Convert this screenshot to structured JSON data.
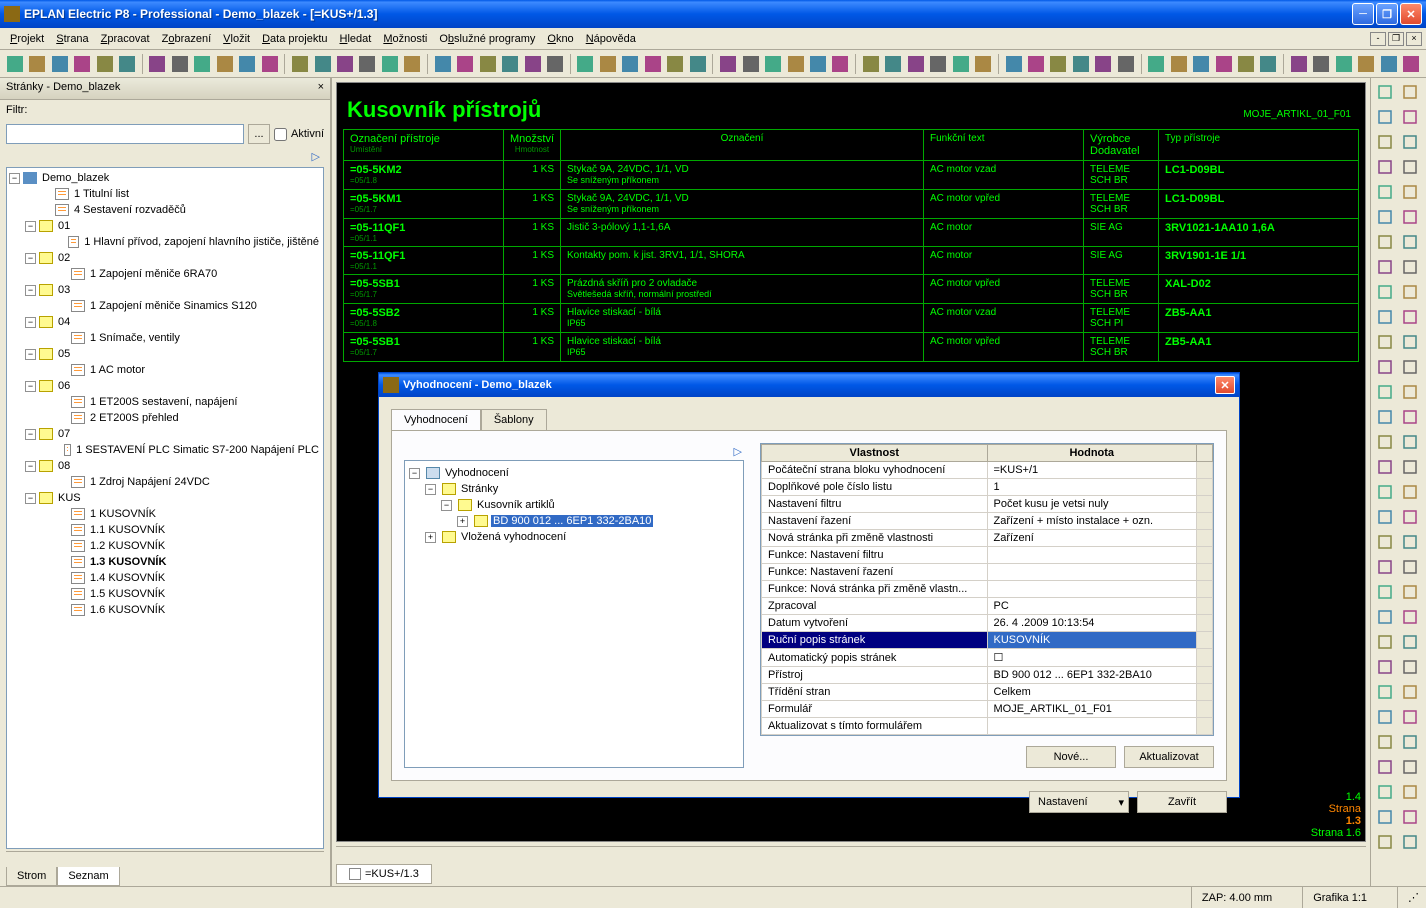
{
  "title": "EPLAN Electric P8 - Professional - Demo_blazek - [=KUS+/1.3]",
  "menu": [
    "Projekt",
    "Strana",
    "Zpracovat",
    "Zobrazení",
    "Vložit",
    "Data projektu",
    "Hledat",
    "Možnosti",
    "Obslužné programy",
    "Okno",
    "Nápověda"
  ],
  "sidebar": {
    "title": "Stránky - Demo_blazek",
    "filter_label": "Filtr:",
    "active_label": "Aktivní",
    "tabs": [
      "Strom",
      "Seznam"
    ],
    "tree": {
      "root": "Demo_blazek",
      "items": [
        {
          "label": "1 Titulní list",
          "type": "page",
          "indent": 2
        },
        {
          "label": "4 Sestavení rozvaděčů",
          "type": "page",
          "indent": 2
        },
        {
          "label": "01",
          "type": "folder",
          "indent": 1,
          "toggle": "-"
        },
        {
          "label": "1 Hlavní přívod, zapojení hlavního jističe, jištěné",
          "type": "page",
          "indent": 3
        },
        {
          "label": "02",
          "type": "folder",
          "indent": 1,
          "toggle": "-"
        },
        {
          "label": "1 Zapojení měniče 6RA70",
          "type": "page",
          "indent": 3
        },
        {
          "label": "03",
          "type": "folder",
          "indent": 1,
          "toggle": "-"
        },
        {
          "label": "1 Zapojení měniče Sinamics S120",
          "type": "page",
          "indent": 3
        },
        {
          "label": "04",
          "type": "folder",
          "indent": 1,
          "toggle": "-"
        },
        {
          "label": "1 Snímače, ventily",
          "type": "page",
          "indent": 3
        },
        {
          "label": "05",
          "type": "folder",
          "indent": 1,
          "toggle": "-"
        },
        {
          "label": "1 AC motor",
          "type": "page",
          "indent": 3
        },
        {
          "label": "06",
          "type": "folder",
          "indent": 1,
          "toggle": "-"
        },
        {
          "label": "1 ET200S sestavení, napájení",
          "type": "page",
          "indent": 3
        },
        {
          "label": "2 ET200S přehled",
          "type": "page",
          "indent": 3
        },
        {
          "label": "07",
          "type": "folder",
          "indent": 1,
          "toggle": "-"
        },
        {
          "label": "1 SESTAVENÍ PLC Simatic  S7-200 Napájení PLC",
          "type": "page",
          "indent": 3
        },
        {
          "label": "08",
          "type": "folder",
          "indent": 1,
          "toggle": "-"
        },
        {
          "label": "1 Zdroj Napájení 24VDC",
          "type": "page",
          "indent": 3
        },
        {
          "label": "KUS",
          "type": "folder",
          "indent": 1,
          "toggle": "-"
        },
        {
          "label": "1 KUSOVNÍK",
          "type": "page",
          "indent": 3
        },
        {
          "label": "1.1 KUSOVNÍK",
          "type": "page",
          "indent": 3
        },
        {
          "label": "1.2 KUSOVNÍK",
          "type": "page",
          "indent": 3
        },
        {
          "label": "1.3 KUSOVNÍK",
          "type": "page",
          "indent": 3,
          "bold": true
        },
        {
          "label": "1.4 KUSOVNÍK",
          "type": "page",
          "indent": 3
        },
        {
          "label": "1.5 KUSOVNÍK",
          "type": "page",
          "indent": 3
        },
        {
          "label": "1.6 KUSOVNÍK",
          "type": "page",
          "indent": 3
        }
      ]
    }
  },
  "drawing": {
    "title": "Kusovník přístrojů",
    "form_id": "MOJE_ARTIKL_01_F01",
    "headers": {
      "col1": "Označení přístroje",
      "col1b": "Umístění",
      "col2": "Množství",
      "col2b": "Hmotnost",
      "col3": "Označení",
      "col4": "Funkční text",
      "col5": "Výrobce",
      "col5b": "Dodavatel",
      "col6": "Typ přístroje"
    },
    "rows": [
      {
        "id": "=05-5KM2",
        "loc": "=05/1.8",
        "qty": "1 KS",
        "desc": "Stykač 9A, 24VDC, 1/1, VD",
        "desc2": "Se sníženým příkonem",
        "func": "AC motor vzad",
        "mfr": "TELEME",
        "sup": "SCH BR",
        "type": "LC1-D09BL"
      },
      {
        "id": "=05-5KM1",
        "loc": "=05/1.7",
        "qty": "1 KS",
        "desc": "Stykač 9A, 24VDC, 1/1, VD",
        "desc2": "Se sníženým příkonem",
        "func": "AC motor vpřed",
        "mfr": "TELEME",
        "sup": "SCH BR",
        "type": "LC1-D09BL"
      },
      {
        "id": "=05-11QF1",
        "loc": "=05/1.1",
        "qty": "1 KS",
        "desc": "Jistič 3-pólový 1,1-1,6A",
        "desc2": "",
        "func": "AC motor",
        "mfr": "SIE AG",
        "sup": "",
        "type": "3RV1021-1AA10 1,6A"
      },
      {
        "id": "=05-11QF1",
        "loc": "=05/1.1",
        "qty": "1 KS",
        "desc": "Kontakty pom. k jist. 3RV1, 1/1, SHORA",
        "desc2": "",
        "func": "AC motor",
        "mfr": "SIE AG",
        "sup": "",
        "type": "3RV1901-1E 1/1"
      },
      {
        "id": "=05-5SB1",
        "loc": "=05/1.7",
        "qty": "1 KS",
        "desc": "Prázdná skříň pro 2 ovladače",
        "desc2": "Světlešedá skříň, normální prostředí",
        "func": "AC motor vpřed",
        "mfr": "TELEME",
        "sup": "SCH BR",
        "type": "XAL-D02"
      },
      {
        "id": "=05-5SB2",
        "loc": "=05/1.8",
        "qty": "1 KS",
        "desc": "Hlavice stiskací - bílá",
        "desc2": "IP65",
        "func": "AC motor vzad",
        "mfr": "TELEME",
        "sup": "SCH PI",
        "type": "ZB5-AA1"
      },
      {
        "id": "=05-5SB1",
        "loc": "=05/1.7",
        "qty": "1 KS",
        "desc": "Hlavice stiskací - bílá",
        "desc2": "IP65",
        "func": "AC motor vpřed",
        "mfr": "TELEME",
        "sup": "SCH BR",
        "type": "ZB5-AA1"
      }
    ],
    "ruler": [
      "1.4",
      "Strana",
      "1.3",
      "Strana",
      "1.6"
    ]
  },
  "center_tab": "=KUS+/1.3",
  "dialog": {
    "title": "Vyhodnocení - Demo_blazek",
    "tabs": [
      "Vyhodnocení",
      "Šablony"
    ],
    "tree": {
      "root": "Vyhodnocení",
      "nodes": [
        {
          "label": "Stránky",
          "indent": 1,
          "toggle": "-",
          "icon": "pages"
        },
        {
          "label": "Kusovník artiklů",
          "indent": 2,
          "toggle": "-",
          "icon": "pages"
        },
        {
          "label": "BD 900 012 ... 6EP1 332-2BA10",
          "indent": 3,
          "toggle": "+",
          "icon": "item",
          "selected": true
        },
        {
          "label": "Vložená vyhodnocení",
          "indent": 1,
          "toggle": "+",
          "icon": "pages"
        }
      ]
    },
    "grid": {
      "col1": "Vlastnost",
      "col2": "Hodnota",
      "rows": [
        {
          "p": "Počáteční strana bloku vyhodnocení",
          "v": "=KUS+/1"
        },
        {
          "p": "Doplňkové pole číslo listu",
          "v": "1"
        },
        {
          "p": "Nastavení filtru",
          "v": "Počet kusu je vetsi nuly"
        },
        {
          "p": "Nastavení řazení",
          "v": "Zařízení + místo instalace + ozn."
        },
        {
          "p": "Nová stránka při změně vlastnosti",
          "v": "Zařízení"
        },
        {
          "p": "Funkce: Nastavení filtru",
          "v": ""
        },
        {
          "p": "Funkce: Nastavení řazení",
          "v": ""
        },
        {
          "p": "Funkce: Nová stránka při změně vlastn...",
          "v": ""
        },
        {
          "p": "Zpracoval",
          "v": "PC"
        },
        {
          "p": "Datum vytvoření",
          "v": "26. 4 .2009 10:13:54"
        },
        {
          "p": "Ruční popis stránek",
          "v": "KUSOVNÍK",
          "selected": true
        },
        {
          "p": "Automatický popis stránek",
          "v": "☐"
        },
        {
          "p": "Přístroj",
          "v": "BD 900 012 ... 6EP1 332-2BA10"
        },
        {
          "p": "Třídění stran",
          "v": "Celkem"
        },
        {
          "p": "Formulář",
          "v": "MOJE_ARTIKL_01_F01"
        },
        {
          "p": "Aktualizovat s tímto formulářem",
          "v": ""
        }
      ]
    },
    "btn_new": "Nové...",
    "btn_update": "Aktualizovat",
    "btn_settings": "Nastavení",
    "btn_close": "Zavřít"
  },
  "status": {
    "zap": "ZAP: 4.00 mm",
    "grafika": "Grafika 1:1"
  }
}
